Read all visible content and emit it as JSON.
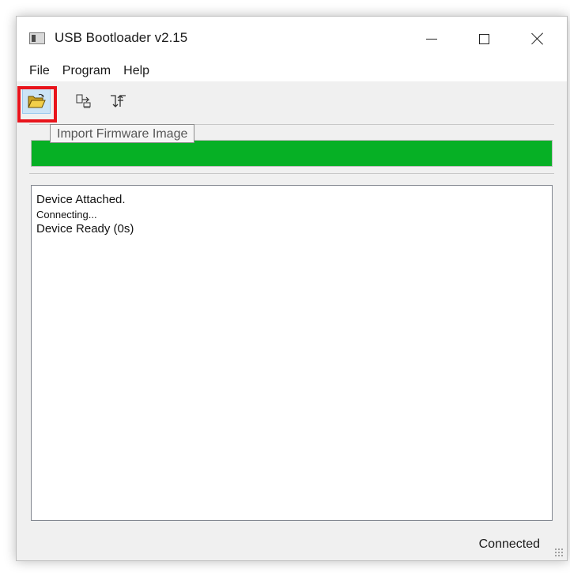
{
  "window": {
    "title": "USB Bootloader v2.15"
  },
  "menu": {
    "items": [
      "File",
      "Program",
      "Help"
    ]
  },
  "toolbar": {
    "buttons": [
      {
        "icon": "open-folder-icon",
        "active": true
      },
      {
        "icon": "program-device-icon",
        "active": false
      },
      {
        "icon": "reset-device-icon",
        "active": false
      }
    ],
    "tooltip": "Import Firmware Image"
  },
  "progress": {
    "value": 1.0,
    "color": "#06b025"
  },
  "log": {
    "lines": [
      "Device Attached.",
      "Connecting...",
      "Device Ready (0s)"
    ]
  },
  "status": {
    "text": "Connected"
  },
  "colors": {
    "highlight": "#e8141c",
    "progress": "#06b025"
  }
}
